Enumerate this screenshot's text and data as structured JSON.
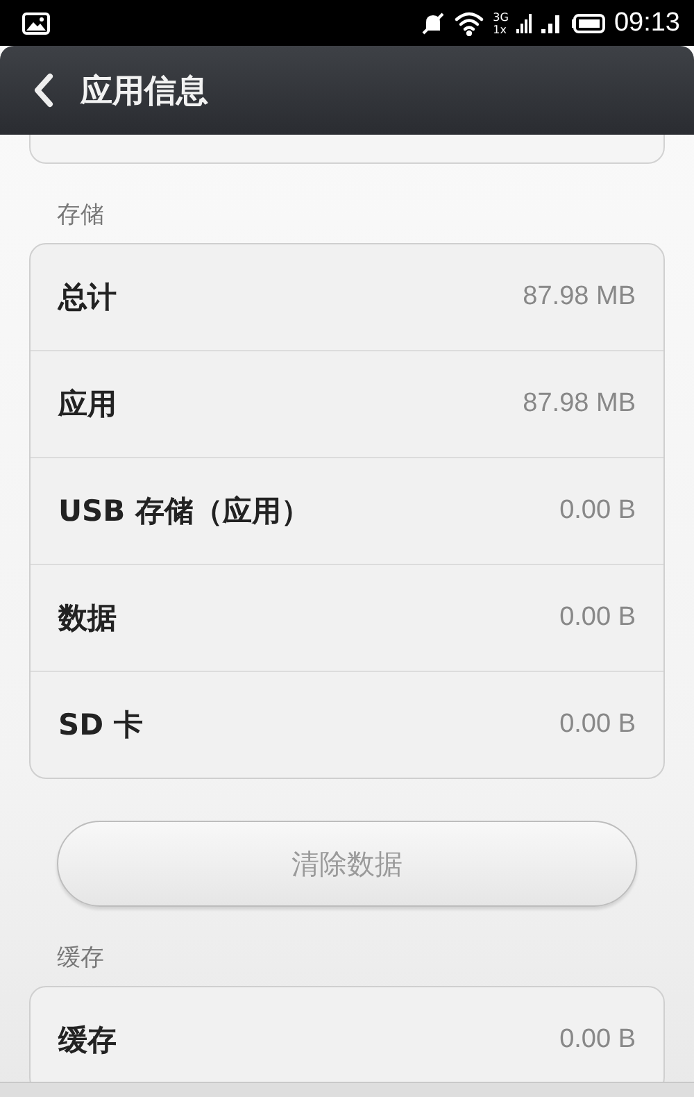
{
  "status_bar": {
    "network_top": "3G",
    "network_bottom": "1x",
    "time": "09:13"
  },
  "title_bar": {
    "title": "应用信息"
  },
  "sections": [
    {
      "header": "存储",
      "rows": [
        {
          "label": "总计",
          "value": "87.98 MB"
        },
        {
          "label": "应用",
          "value": "87.98 MB"
        },
        {
          "label": "USB 存储（应用）",
          "value": "0.00 B"
        },
        {
          "label": "数据",
          "value": "0.00 B"
        },
        {
          "label": "SD 卡",
          "value": "0.00 B"
        }
      ],
      "button": {
        "label": "清除数据",
        "disabled": true
      }
    },
    {
      "header": "缓存",
      "rows": [
        {
          "label": "缓存",
          "value": "0.00 B"
        }
      ]
    }
  ]
}
